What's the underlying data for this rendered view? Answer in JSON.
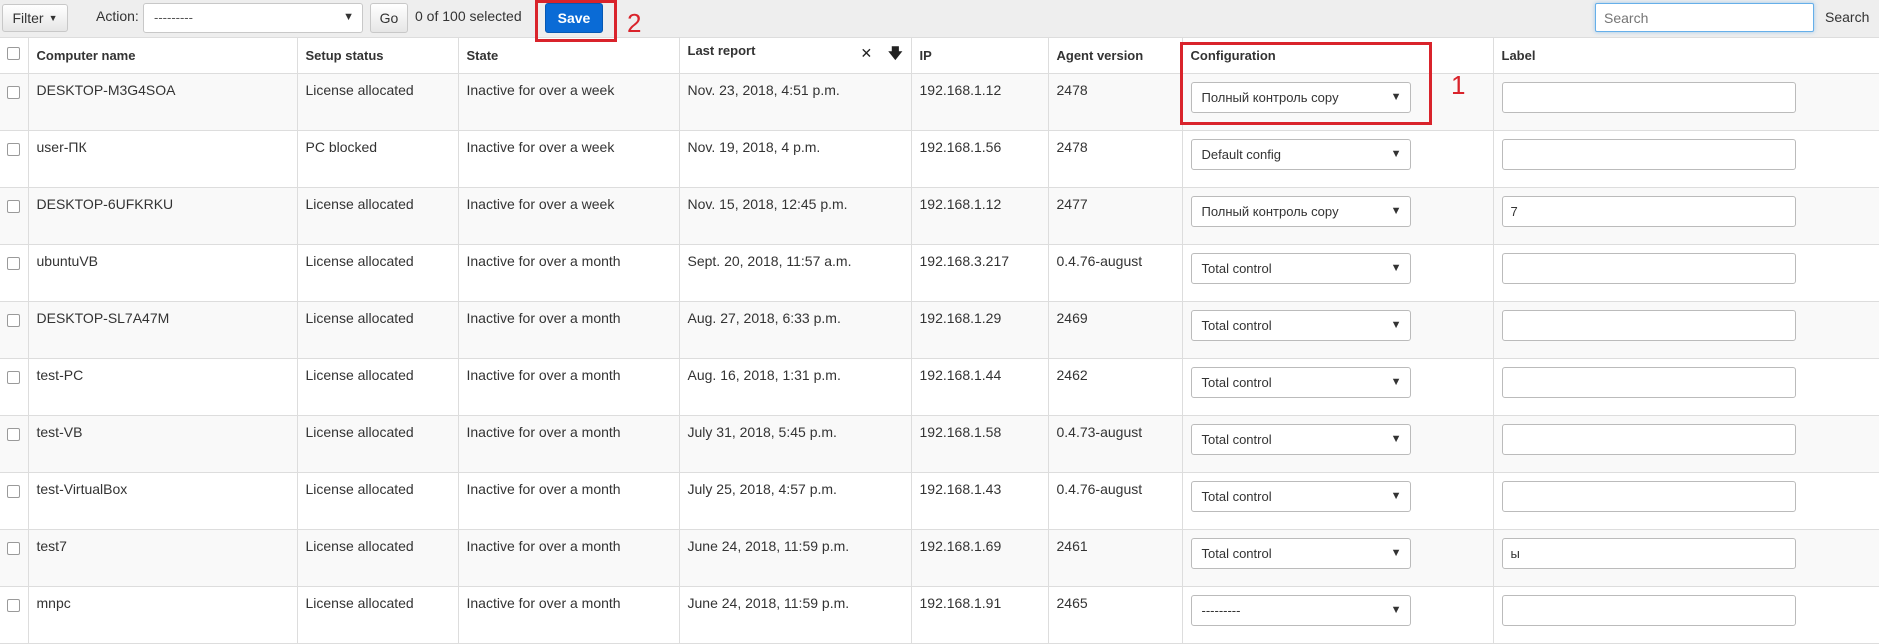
{
  "toolbar": {
    "filter_label": "Filter",
    "action_label": "Action:",
    "action_value": "---------",
    "go_label": "Go",
    "selected_text": "0 of 100 selected",
    "save_label": "Save",
    "search_placeholder": "Search",
    "search_button": "Search"
  },
  "annotations": {
    "one": "1",
    "two": "2"
  },
  "columns": {
    "computer_name": "Computer name",
    "setup_status": "Setup status",
    "state": "State",
    "last_report": "Last report",
    "ip": "IP",
    "agent_version": "Agent version",
    "configuration": "Configuration",
    "label": "Label"
  },
  "sort_tools": {
    "clear": "✕",
    "down": "🡇"
  },
  "rows": [
    {
      "name": "DESKTOP-M3G4SOA",
      "status": "License allocated",
      "state": "Inactive for over a week",
      "last_report": "Nov. 23, 2018, 4:51 p.m.",
      "ip": "192.168.1.12",
      "agent": "2478",
      "config": "Полный контроль copy",
      "label": ""
    },
    {
      "name": "user-ПК",
      "status": "PC blocked",
      "state": "Inactive for over a week",
      "last_report": "Nov. 19, 2018, 4 p.m.",
      "ip": "192.168.1.56",
      "agent": "2478",
      "config": "Default config",
      "label": ""
    },
    {
      "name": "DESKTOP-6UFKRKU",
      "status": "License allocated",
      "state": "Inactive for over a week",
      "last_report": "Nov. 15, 2018, 12:45 p.m.",
      "ip": "192.168.1.12",
      "agent": "2477",
      "config": "Полный контроль copy",
      "label": "7"
    },
    {
      "name": "ubuntuVB",
      "status": "License allocated",
      "state": "Inactive for over a month",
      "last_report": "Sept. 20, 2018, 11:57 a.m.",
      "ip": "192.168.3.217",
      "agent": "0.4.76-august",
      "config": "Total control",
      "label": ""
    },
    {
      "name": "DESKTOP-SL7A47M",
      "status": "License allocated",
      "state": "Inactive for over a month",
      "last_report": "Aug. 27, 2018, 6:33 p.m.",
      "ip": "192.168.1.29",
      "agent": "2469",
      "config": "Total control",
      "label": ""
    },
    {
      "name": "test-PC",
      "status": "License allocated",
      "state": "Inactive for over a month",
      "last_report": "Aug. 16, 2018, 1:31 p.m.",
      "ip": "192.168.1.44",
      "agent": "2462",
      "config": "Total control",
      "label": ""
    },
    {
      "name": "test-VB",
      "status": "License allocated",
      "state": "Inactive for over a month",
      "last_report": "July 31, 2018, 5:45 p.m.",
      "ip": "192.168.1.58",
      "agent": "0.4.73-august",
      "config": "Total control",
      "label": ""
    },
    {
      "name": "test-VirtualBox",
      "status": "License allocated",
      "state": "Inactive for over a month",
      "last_report": "July 25, 2018, 4:57 p.m.",
      "ip": "192.168.1.43",
      "agent": "0.4.76-august",
      "config": "Total control",
      "label": ""
    },
    {
      "name": "test7",
      "status": "License allocated",
      "state": "Inactive for over a month",
      "last_report": "June 24, 2018, 11:59 p.m.",
      "ip": "192.168.1.69",
      "agent": "2461",
      "config": "Total control",
      "label": "ы"
    },
    {
      "name": "mnpc",
      "status": "License allocated",
      "state": "Inactive for over a month",
      "last_report": "June 24, 2018, 11:59 p.m.",
      "ip": "192.168.1.91",
      "agent": "2465",
      "config": "---------",
      "label": ""
    }
  ],
  "colors": {
    "save_button": "#0a6bd6",
    "annotation_red": "#d9232b",
    "row_stripe": "#f9f9f9"
  }
}
